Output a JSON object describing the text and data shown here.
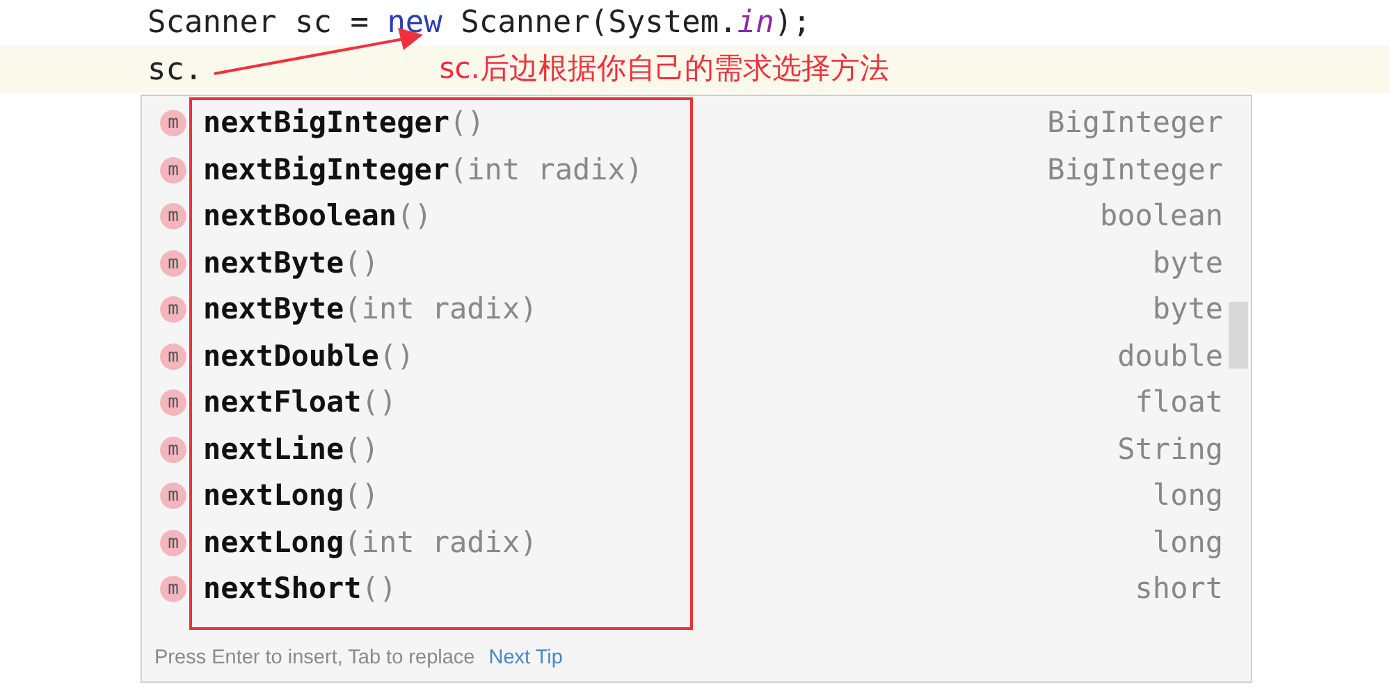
{
  "editor": {
    "lines": [
      {
        "tokens": [
          {
            "kind": "plain",
            "text": "Scanner sc = "
          },
          {
            "kind": "keyword",
            "text": "new"
          },
          {
            "kind": "plain",
            "text": " Scanner(System."
          },
          {
            "kind": "field",
            "text": "in"
          },
          {
            "kind": "plain",
            "text": ");"
          }
        ]
      },
      {
        "current": true,
        "tokens": [
          {
            "kind": "plain",
            "text": "sc."
          }
        ]
      }
    ]
  },
  "annotation": {
    "text": "sc.后边根据你自己的需求选择方法"
  },
  "completion": {
    "items": [
      {
        "icon": "m",
        "name": "nextBigInteger",
        "params": "()",
        "type": "BigInteger"
      },
      {
        "icon": "m",
        "name": "nextBigInteger",
        "params": "(int radix)",
        "type": "BigInteger"
      },
      {
        "icon": "m",
        "name": "nextBoolean",
        "params": "()",
        "type": "boolean"
      },
      {
        "icon": "m",
        "name": "nextByte",
        "params": "()",
        "type": "byte"
      },
      {
        "icon": "m",
        "name": "nextByte",
        "params": "(int radix)",
        "type": "byte"
      },
      {
        "icon": "m",
        "name": "nextDouble",
        "params": "()",
        "type": "double"
      },
      {
        "icon": "m",
        "name": "nextFloat",
        "params": "()",
        "type": "float"
      },
      {
        "icon": "m",
        "name": "nextLine",
        "params": "()",
        "type": "String"
      },
      {
        "icon": "m",
        "name": "nextLong",
        "params": "()",
        "type": "long"
      },
      {
        "icon": "m",
        "name": "nextLong",
        "params": "(int radix)",
        "type": "long"
      },
      {
        "icon": "m",
        "name": "nextShort",
        "params": "()",
        "type": "short"
      }
    ],
    "footer": {
      "hint": "Press Enter to insert, Tab to replace",
      "link": "Next Tip"
    }
  }
}
